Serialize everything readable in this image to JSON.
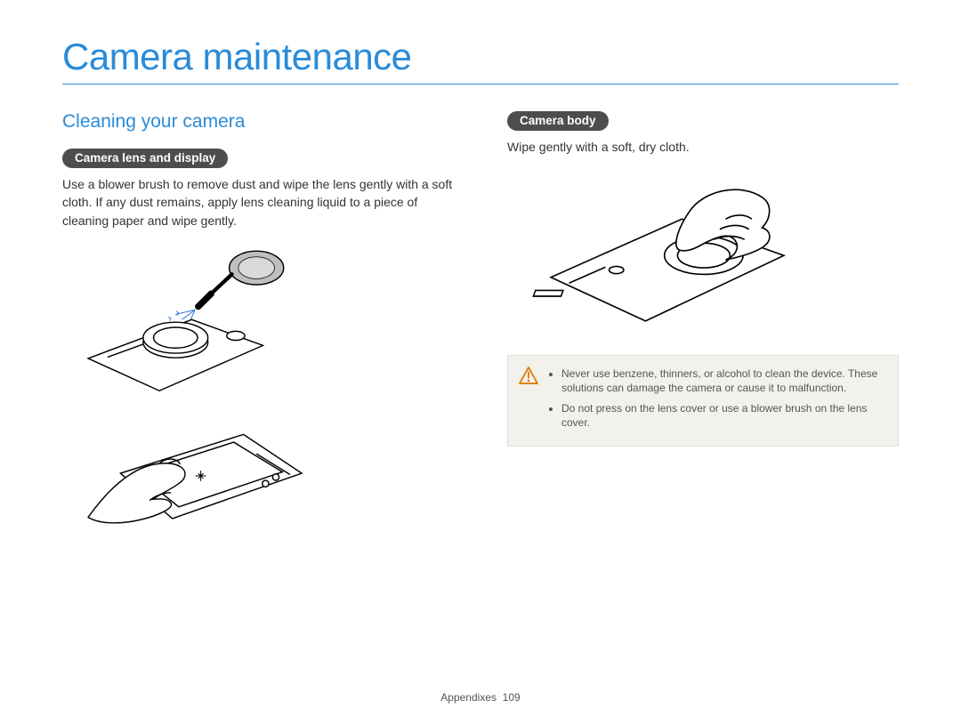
{
  "title": "Camera maintenance",
  "heading": "Cleaning your camera",
  "left": {
    "pill": "Camera lens and display",
    "body": "Use a blower brush to remove dust and wipe the lens gently with a soft cloth. If any dust remains, apply lens cleaning liquid to a piece of cleaning paper and wipe gently."
  },
  "right": {
    "pill": "Camera body",
    "body": "Wipe gently with a soft, dry cloth."
  },
  "caution": {
    "item1": "Never use benzene, thinners, or alcohol to clean the device. These solutions can damage the camera or cause it to malfunction.",
    "item2": "Do not press on the lens cover or use a blower brush on the lens cover."
  },
  "footer": {
    "section": "Appendixes",
    "page": "109"
  }
}
